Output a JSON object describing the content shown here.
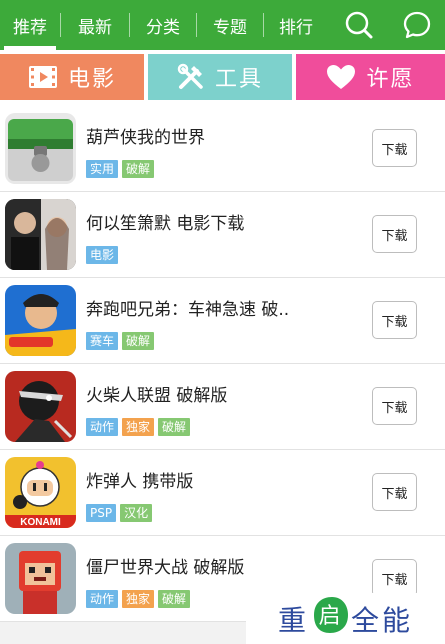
{
  "nav": {
    "tabs": [
      "推荐",
      "最新",
      "分类",
      "专题",
      "排行"
    ],
    "active_index": 0,
    "icons": [
      "search-icon",
      "chat-icon"
    ]
  },
  "categories": [
    {
      "label": "电影",
      "icon": "film-icon",
      "color": "#f0885f"
    },
    {
      "label": "工具",
      "icon": "tools-icon",
      "color": "#7dd1cc"
    },
    {
      "label": "许愿",
      "icon": "heart-icon",
      "color": "#f04d9b"
    }
  ],
  "download_label": "下载",
  "apps": [
    {
      "title": "葫芦侠我的世界",
      "tags": [
        {
          "text": "实用",
          "color": "blue"
        },
        {
          "text": "破解",
          "color": "green"
        }
      ]
    },
    {
      "title": "何以笙箫默  电影下载",
      "tags": [
        {
          "text": "电影",
          "color": "blue"
        }
      ]
    },
    {
      "title": "奔跑吧兄弟：车神急速  破..",
      "tags": [
        {
          "text": "赛车",
          "color": "blue"
        },
        {
          "text": "破解",
          "color": "green"
        }
      ]
    },
    {
      "title": "火柴人联盟  破解版",
      "tags": [
        {
          "text": "动作",
          "color": "blue"
        },
        {
          "text": "独家",
          "color": "orange"
        },
        {
          "text": "破解",
          "color": "green"
        }
      ]
    },
    {
      "title": "炸弹人  携带版",
      "tags": [
        {
          "text": "PSP",
          "color": "blue"
        },
        {
          "text": "汉化",
          "color": "green"
        }
      ]
    },
    {
      "title": "僵尸世界大战  破解版",
      "tags": [
        {
          "text": "动作",
          "color": "blue"
        },
        {
          "text": "独家",
          "color": "orange"
        },
        {
          "text": "破解",
          "color": "green"
        }
      ]
    }
  ],
  "watermark": {
    "left": "重",
    "leaf": "启",
    "right": "全能"
  },
  "colors": {
    "nav_green": "#3daa3a",
    "tag_blue": "#6cb7e8",
    "tag_green": "#86c872",
    "tag_orange": "#f3a24e"
  }
}
